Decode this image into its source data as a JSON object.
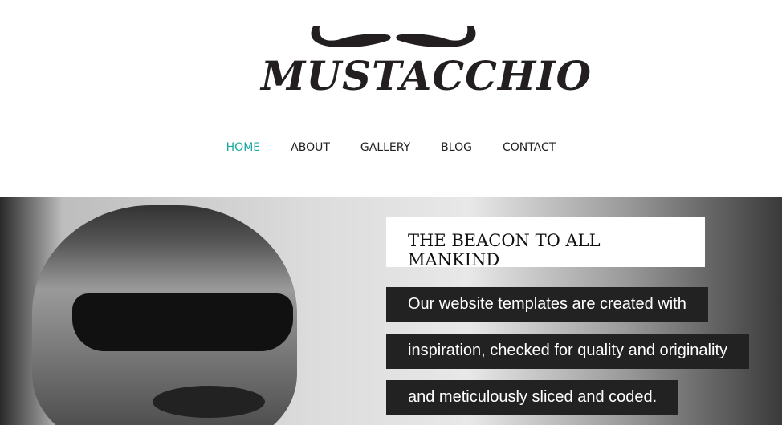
{
  "logo": {
    "text": "MUSTACCHIO"
  },
  "nav": {
    "items": [
      {
        "label": "HOME",
        "active": true
      },
      {
        "label": "ABOUT"
      },
      {
        "label": "GALLERY"
      },
      {
        "label": "BLOG"
      },
      {
        "label": "CONTACT"
      }
    ],
    "active_color": "#1aa89e"
  },
  "hero": {
    "title": "THE BEACON TO ALL MANKIND",
    "lines": [
      "Our website templates are created with",
      "inspiration, checked for quality and originality",
      "and meticulously sliced and coded."
    ]
  }
}
